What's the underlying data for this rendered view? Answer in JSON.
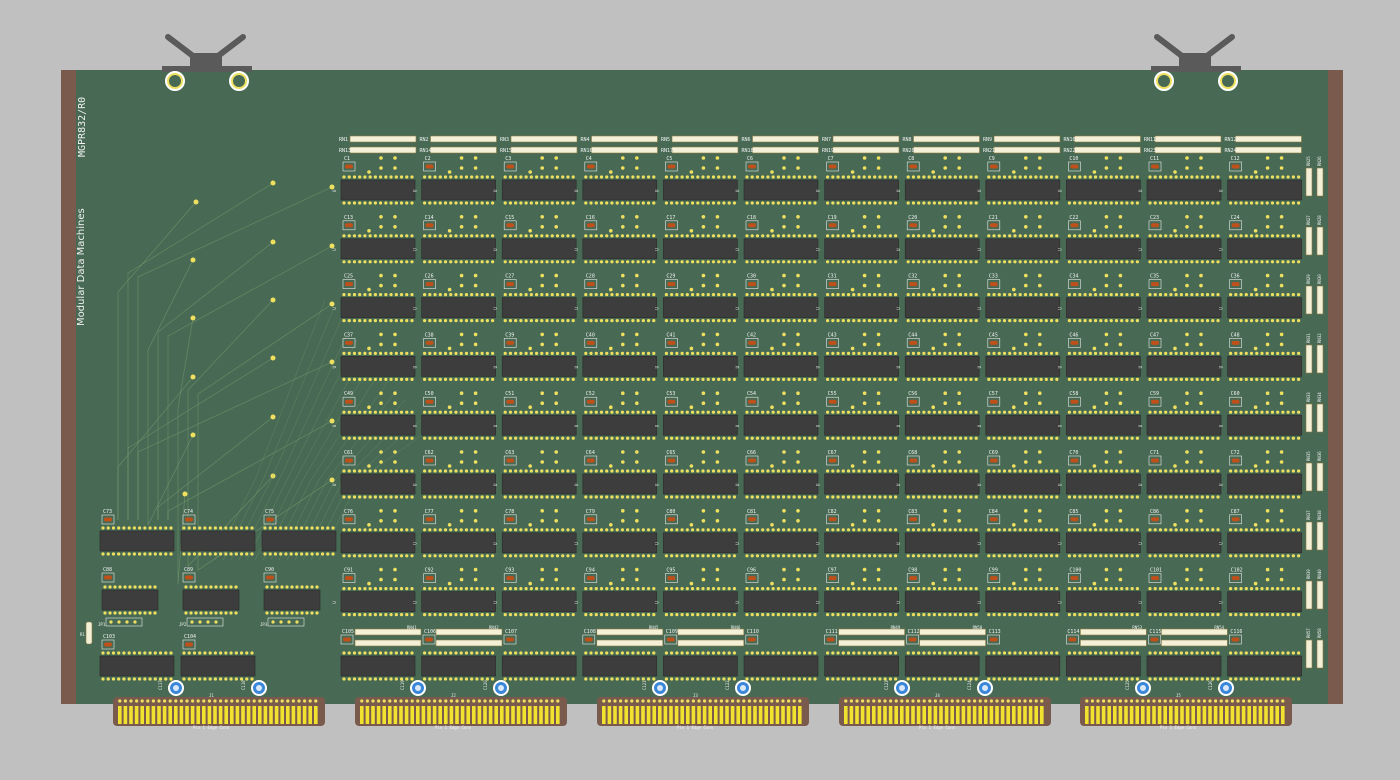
{
  "board": {
    "part_number": "MGPR832/R0",
    "maker": "Modular Data Machines"
  },
  "colors": {
    "background": "#c0c0c0",
    "pcb": "#486a54",
    "edge": "#7a5a4c",
    "ic_body": "#3d3d3d",
    "pad": "#f0e060",
    "cap": "#c0501a",
    "gold_finger": "#f2e230",
    "rn_body": "#f4f0d8",
    "mount_hole": "#3a86d8",
    "latch": "#5a5a5a"
  },
  "resistor_networks_top": [
    "RN1",
    "RN2",
    "RN3",
    "RN4",
    "RN5",
    "RN6",
    "RN7",
    "RN8",
    "RN9",
    "RN10",
    "RN11",
    "RN12",
    "RN13",
    "RN14",
    "RN15",
    "RN16",
    "RN17",
    "RN18",
    "RN19",
    "RN20",
    "RN21",
    "RN22",
    "RN23",
    "RN24"
  ],
  "resistor_networks_right": [
    "RN25",
    "RN26",
    "RN27",
    "RN28",
    "RN29",
    "RN30",
    "RN31",
    "RN32",
    "RN33",
    "RN34",
    "RN35",
    "RN36",
    "RN37",
    "RN38",
    "RN39",
    "RN40",
    "RN57",
    "RN58"
  ],
  "bottom_rns": [
    "RN41",
    "RN42",
    "RN43",
    "RN44",
    "RN45",
    "RN46",
    "RN47",
    "RN48",
    "RN49",
    "RN50",
    "RN51",
    "RN52",
    "RN53",
    "RN54",
    "RN55",
    "RN56"
  ],
  "bottom_caps": [
    "C105",
    "C106",
    "C107",
    "C108",
    "C109",
    "C110",
    "C111",
    "C112",
    "C113",
    "C114",
    "C115",
    "C116"
  ],
  "mount_caps": [
    "C117",
    "C118",
    "C119",
    "C120",
    "C121",
    "C122",
    "C123",
    "C124",
    "C125",
    "C126"
  ],
  "connectors": [
    "J1",
    "J2",
    "J3",
    "J4",
    "J5"
  ],
  "connector_note": "Pin 1 Edge Conn",
  "left_column_caps": [
    "C73",
    "C74",
    "C75",
    "C88",
    "C89",
    "C90",
    "C103",
    "C104"
  ],
  "jumpers": [
    "JP1",
    "JP2",
    "JP3"
  ],
  "r1": "R1"
}
